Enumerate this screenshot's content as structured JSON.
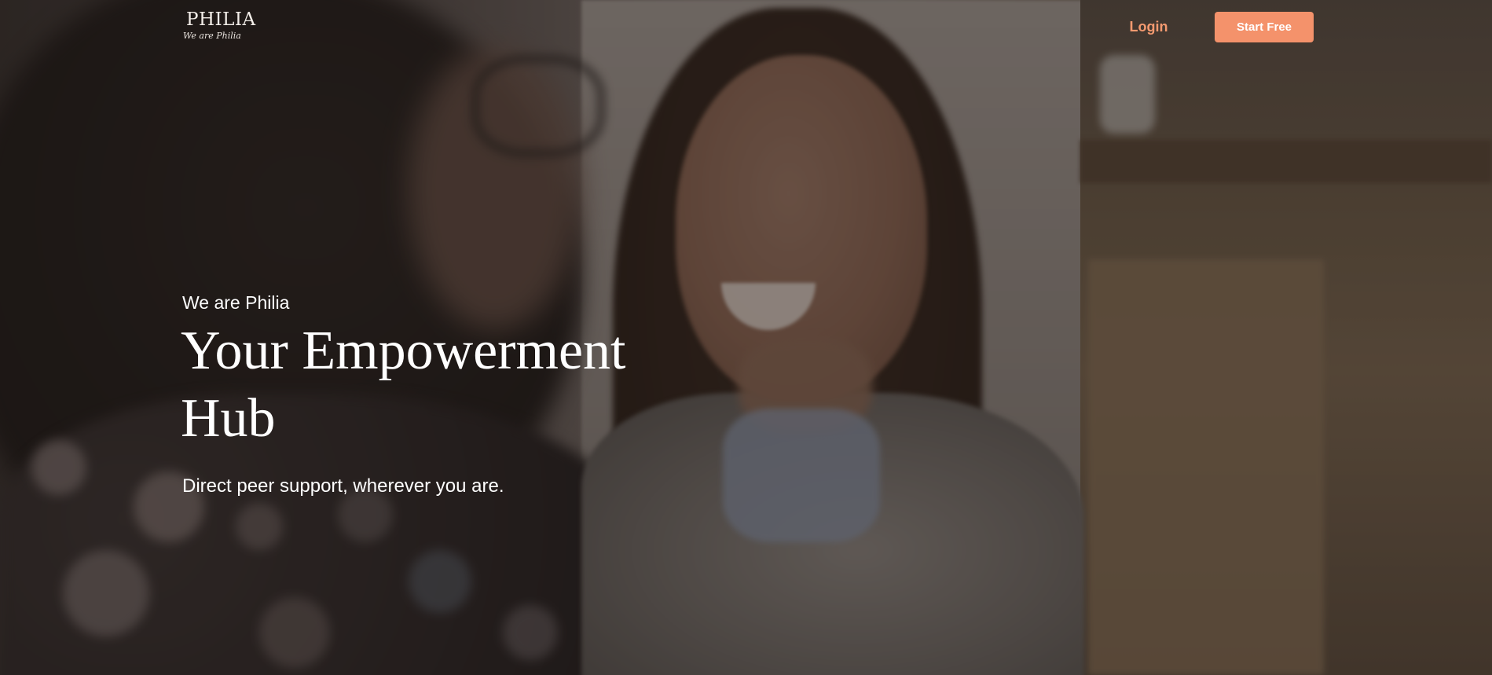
{
  "header": {
    "logo": {
      "title": "PHILIA",
      "tagline": "We are Philia"
    },
    "nav": {
      "login_label": "Login",
      "start_label": "Start Free"
    }
  },
  "hero": {
    "eyebrow": "We are Philia",
    "headline": "Your Empowerment Hub",
    "subheadline": "Direct peer support, wherever you are.",
    "background_image": "two women laughing together at a table"
  },
  "colors": {
    "accent": "#f4926b",
    "login_text": "#f49a70",
    "text": "#ffffff"
  }
}
